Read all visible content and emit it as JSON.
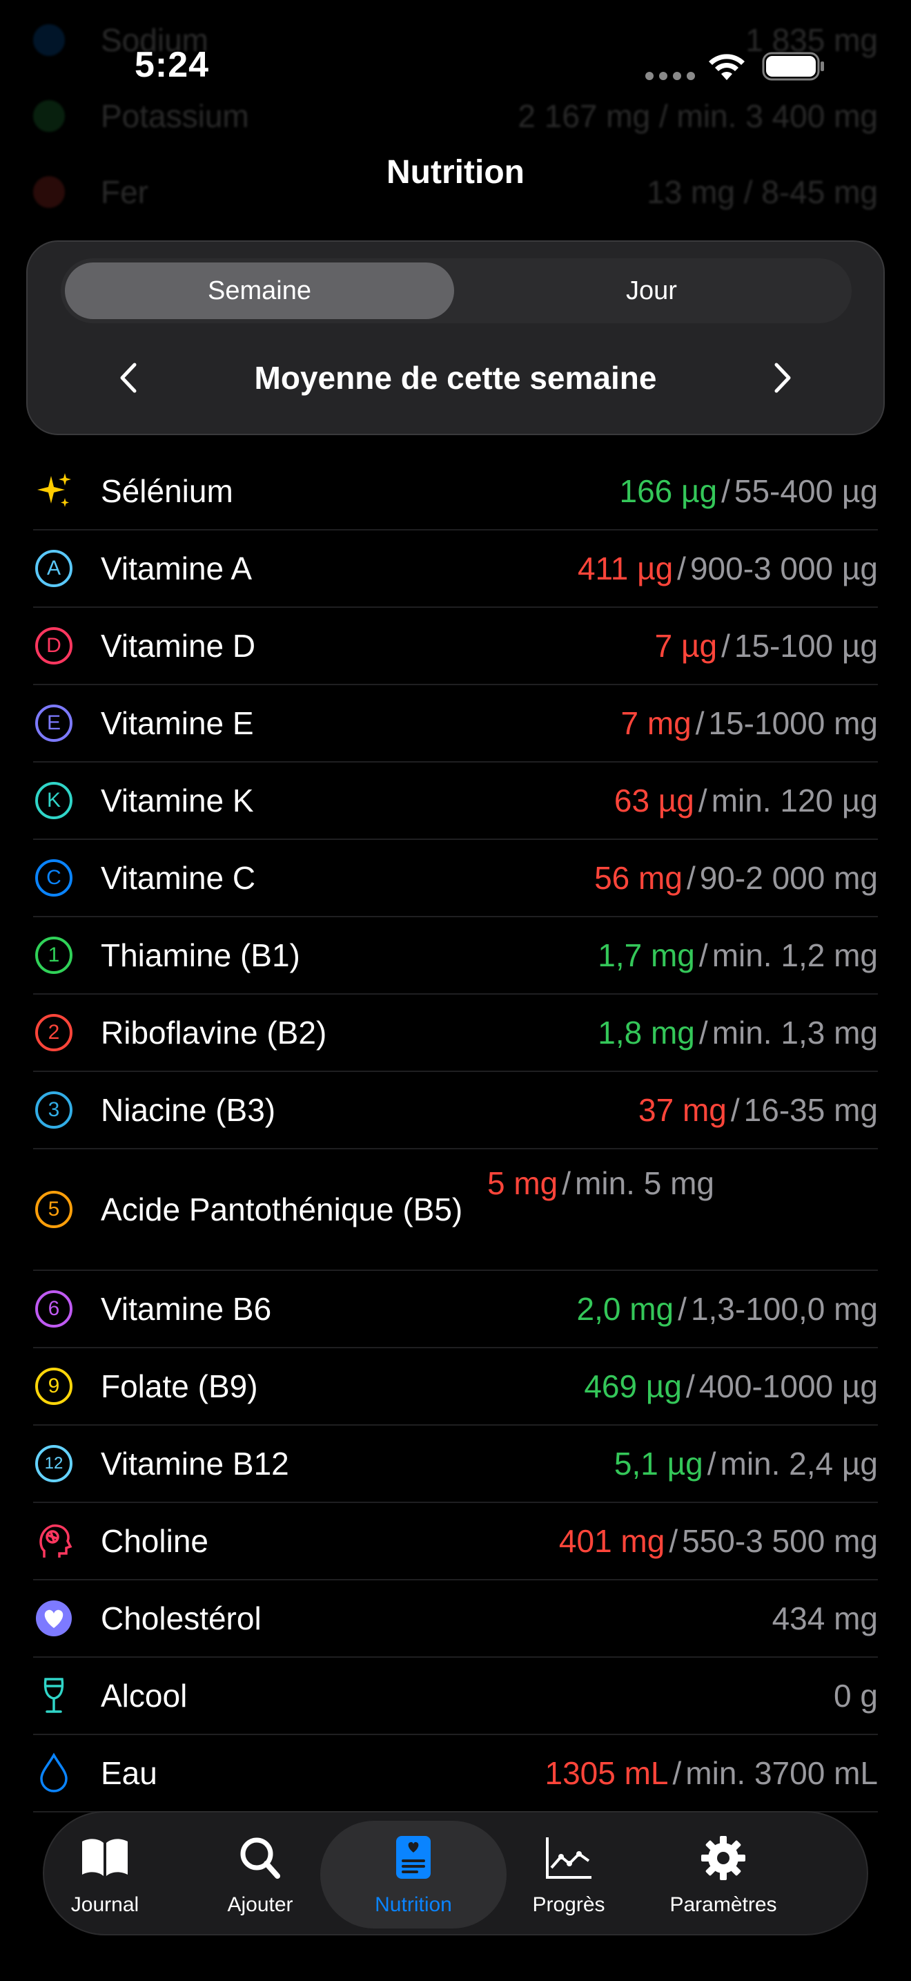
{
  "status_bar": {
    "time": "5:24"
  },
  "header": {
    "title": "Nutrition"
  },
  "background_rows": [
    {
      "label": "Sodium",
      "value": "1 835 mg",
      "color": "#0a84ff"
    },
    {
      "label": "Potassium",
      "value": "2 167 mg / min. 3 400 mg",
      "color": "#34c759"
    },
    {
      "label": "Fer",
      "value": "13 mg / 8-45 mg",
      "color": "#ff453a"
    }
  ],
  "period_card": {
    "segments": [
      {
        "label": "Semaine",
        "active": true
      },
      {
        "label": "Jour",
        "active": false
      }
    ],
    "period_label": "Moyenne de cette semaine"
  },
  "nutrients": [
    {
      "label": "Sélénium",
      "amount": "166 µg",
      "status": "good",
      "ref": "55-400 µg",
      "icon": "sparkles-icon",
      "color": "#ffcc00"
    },
    {
      "label": "Vitamine A",
      "amount": "411 µg",
      "status": "bad",
      "ref": "900-3 000 µg",
      "icon": "A",
      "color": "#5ac8fa"
    },
    {
      "label": "Vitamine D",
      "amount": "7 µg",
      "status": "bad",
      "ref": "15-100 µg",
      "icon": "D",
      "color": "#ff375f"
    },
    {
      "label": "Vitamine E",
      "amount": "7 mg",
      "status": "bad",
      "ref": "15-1000 mg",
      "icon": "E",
      "color": "#7d7aff"
    },
    {
      "label": "Vitamine K",
      "amount": "63 µg",
      "status": "bad",
      "ref": "min. 120 µg",
      "icon": "K",
      "color": "#30d5c8"
    },
    {
      "label": "Vitamine C",
      "amount": "56 mg",
      "status": "bad",
      "ref": "90-2 000 mg",
      "icon": "C",
      "color": "#0a84ff"
    },
    {
      "label": "Thiamine (B1)",
      "amount": "1,7 mg",
      "status": "good",
      "ref": "min. 1,2 mg",
      "icon": "1",
      "color": "#30d158"
    },
    {
      "label": "Riboflavine (B2)",
      "amount": "1,8 mg",
      "status": "good",
      "ref": "min. 1,3 mg",
      "icon": "2",
      "color": "#ff453a"
    },
    {
      "label": "Niacine (B3)",
      "amount": "37 mg",
      "status": "bad",
      "ref": "16-35 mg",
      "icon": "3",
      "color": "#32ade6"
    },
    {
      "label": "Acide Pantothénique (B5)",
      "amount": "5 mg",
      "status": "bad",
      "ref": "min. 5 mg",
      "icon": "5",
      "color": "#ff9f0a"
    },
    {
      "label": "Vitamine B6",
      "amount": "2,0 mg",
      "status": "good",
      "ref": "1,3-100,0 mg",
      "icon": "6",
      "color": "#bf5af2"
    },
    {
      "label": "Folate (B9)",
      "amount": "469 µg",
      "status": "good",
      "ref": "400-1000 µg",
      "icon": "9",
      "color": "#ffd60a"
    },
    {
      "label": "Vitamine B12",
      "amount": "5,1 µg",
      "status": "good",
      "ref": "min. 2,4 µg",
      "icon": "12",
      "color": "#64d2ff"
    },
    {
      "label": "Choline",
      "amount": "401 mg",
      "status": "bad",
      "ref": "550-3 500 mg",
      "icon": "brain-head-icon",
      "color": "#ff375f"
    },
    {
      "label": "Cholestérol",
      "amount": "",
      "status": "plain",
      "ref": "434 mg",
      "icon": "heart-circle-icon",
      "color": "#7d7aff"
    },
    {
      "label": "Alcool",
      "amount": "",
      "status": "plain",
      "ref": "0 g",
      "icon": "wine-glass-icon",
      "color": "#30d5c8"
    },
    {
      "label": "Eau",
      "amount": "1305 mL",
      "status": "bad",
      "ref": "min. 3700 mL",
      "icon": "water-drop-icon",
      "color": "#0a84ff"
    }
  ],
  "tab_bar": {
    "tabs": [
      {
        "label": "Journal",
        "icon": "book-icon",
        "selected": false
      },
      {
        "label": "Ajouter",
        "icon": "search-icon",
        "selected": false
      },
      {
        "label": "Nutrition",
        "icon": "nutrition-icon",
        "selected": true
      },
      {
        "label": "Progrès",
        "icon": "chart-icon",
        "selected": false
      },
      {
        "label": "Paramètres",
        "icon": "gear-icon",
        "selected": false
      }
    ],
    "accent": "#0a84ff"
  }
}
